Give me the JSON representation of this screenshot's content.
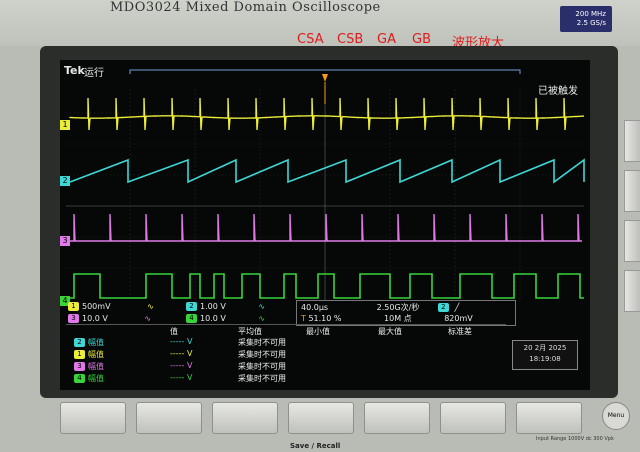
{
  "device": {
    "model_text": "MDO3024  Mixed Domain Oscilloscope",
    "badge_line1": "200 MHz",
    "badge_line2": "2.5 GS/s",
    "menu_button": "Menu"
  },
  "overlay_labels": [
    "CSA",
    "CSB",
    "GA",
    "GB",
    "波形放大"
  ],
  "colors": {
    "ch1": "#ecec3a",
    "ch2": "#3fd6d6",
    "ch3": "#e07ae8",
    "ch4": "#38d43a",
    "overlay": "#e01b1b"
  },
  "screen": {
    "brand": "Tek",
    "run_state": "运行",
    "trigger_status": "已被触发",
    "channel_markers": [
      "1",
      "2",
      "3",
      "4"
    ]
  },
  "readouts": {
    "ch1": {
      "num": "1",
      "scale": "500mV",
      "coupling": "∿"
    },
    "ch2": {
      "num": "2",
      "scale": "1.00 V",
      "coupling": "∿"
    },
    "ch3": {
      "num": "3",
      "scale": "10.0 V",
      "coupling": "∿"
    },
    "ch4": {
      "num": "4",
      "scale": "10.0 V",
      "coupling": "∿"
    },
    "timebase": "40.0μs",
    "trigger_pos": "51.10 %",
    "sample_rate": "2.50G次/秒",
    "record_length": "10M 点",
    "trig_channel": "2",
    "trig_slope": "╱",
    "trig_level": "820mV"
  },
  "measurements": {
    "headers": [
      "值",
      "平均值",
      "最小值",
      "最大值",
      "标准差"
    ],
    "rows": [
      {
        "ch": "2",
        "name": "幅值",
        "value": "----- V",
        "mean": "采集时不可用"
      },
      {
        "ch": "1",
        "name": "幅值",
        "value": "----- V",
        "mean": "采集时不可用"
      },
      {
        "ch": "3",
        "name": "幅值",
        "value": "----- V",
        "mean": "采集时不可用"
      },
      {
        "ch": "4",
        "name": "幅值",
        "value": "----- V",
        "mean": "采集时不可用"
      }
    ]
  },
  "datetime": {
    "date": "20 2月 2025",
    "time": "18:19:08"
  },
  "front_panel": {
    "save_recall": "Save / Recall",
    "small_note": "Input Range 1000V dc 300 Vpk"
  }
}
